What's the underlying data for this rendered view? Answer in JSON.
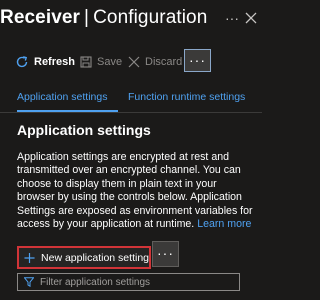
{
  "header": {
    "title_primary": "Receiver",
    "title_separator": "|",
    "title_secondary": "Configuration",
    "more_icon": "ellipsis-icon",
    "close_icon": "close-icon"
  },
  "toolbar": {
    "refresh_label": "Refresh",
    "save_label": "Save",
    "discard_label": "Discard",
    "more_label": "···"
  },
  "tabs": [
    {
      "label": "Application settings",
      "selected": true
    },
    {
      "label": "Function runtime settings",
      "selected": false
    }
  ],
  "section": {
    "heading": "Application settings",
    "description": "Application settings are encrypted at rest and transmitted over an encrypted channel. You can choose to display them in plain text in your browser by using the controls below. Application Settings are exposed as environment variables for access by your application at runtime.",
    "learn_more": "Learn more"
  },
  "actions": {
    "new_setting_label": "New application setting",
    "more_label": "···"
  },
  "filter": {
    "placeholder": "Filter application settings",
    "value": ""
  },
  "colors": {
    "background": "#1b1a19",
    "accent": "#4fa1f0",
    "highlight_border": "#d13438"
  }
}
